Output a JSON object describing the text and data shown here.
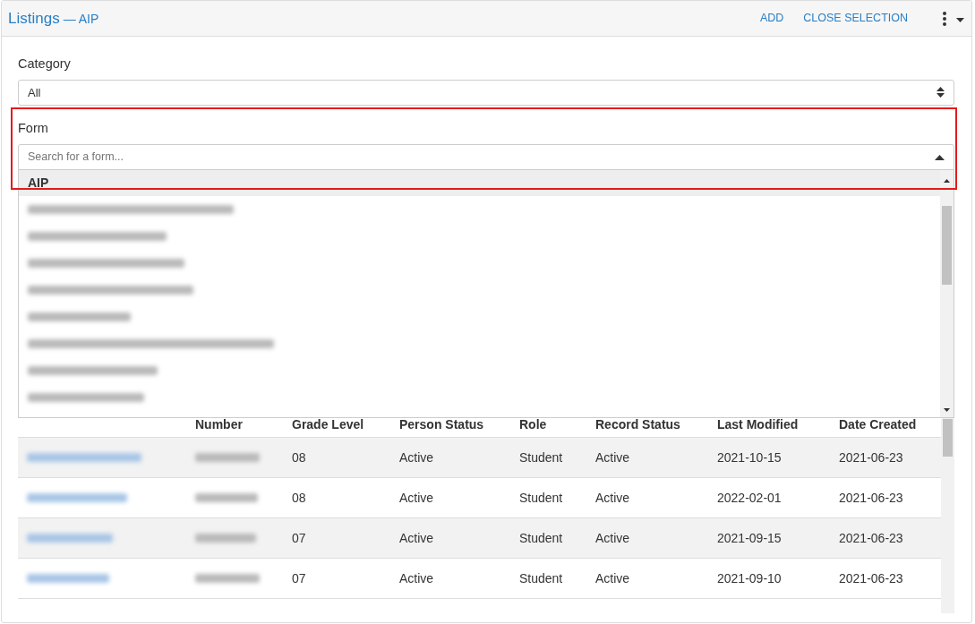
{
  "header": {
    "title": "Listings",
    "subtitle": "— AIP",
    "actions": [
      "ADD",
      "CLOSE SELECTION"
    ]
  },
  "category": {
    "label": "Category",
    "value": "All"
  },
  "form": {
    "label": "Form",
    "placeholder": "Search for a form...",
    "expanded": true,
    "options": [
      {
        "kind": "text",
        "label": "AIP",
        "selected": true
      },
      {
        "kind": "redacted",
        "selected": false
      },
      {
        "kind": "redacted",
        "selected": false
      },
      {
        "kind": "redacted",
        "selected": false
      },
      {
        "kind": "redacted",
        "selected": false
      },
      {
        "kind": "redacted",
        "selected": false
      },
      {
        "kind": "redacted",
        "selected": false
      },
      {
        "kind": "redacted",
        "selected": false
      },
      {
        "kind": "redacted",
        "selected": false
      }
    ]
  },
  "table": {
    "columns": [
      "Number",
      "Grade Level",
      "Person Status",
      "Role",
      "Record Status",
      "Last Modified",
      "Date Created"
    ],
    "rows": [
      {
        "grade": "08",
        "person_status": "Active",
        "role": "Student",
        "record_status": "Active",
        "last_modified": "2021-10-15",
        "date_created": "2021-06-23"
      },
      {
        "grade": "08",
        "person_status": "Active",
        "role": "Student",
        "record_status": "Active",
        "last_modified": "2022-02-01",
        "date_created": "2021-06-23"
      },
      {
        "grade": "07",
        "person_status": "Active",
        "role": "Student",
        "record_status": "Active",
        "last_modified": "2021-09-15",
        "date_created": "2021-06-23"
      },
      {
        "grade": "07",
        "person_status": "Active",
        "role": "Student",
        "record_status": "Active",
        "last_modified": "2021-09-10",
        "date_created": "2021-06-23"
      }
    ]
  }
}
